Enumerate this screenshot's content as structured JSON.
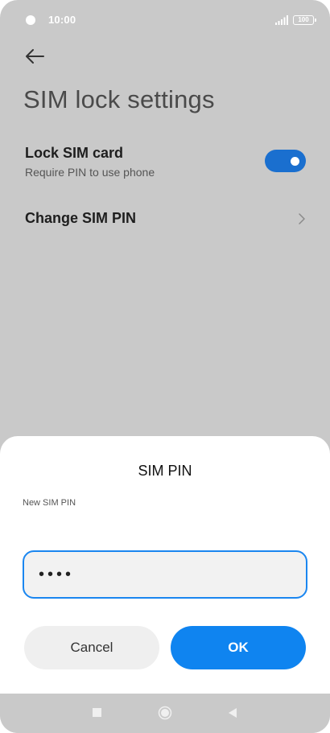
{
  "status_bar": {
    "time": "10:00",
    "battery": "100",
    "icons": [
      "status-dot-icon",
      "signal-icon",
      "battery-icon"
    ]
  },
  "header": {
    "back_icon": "back-arrow-icon",
    "title": "SIM lock settings"
  },
  "settings": {
    "lock_sim": {
      "title": "Lock SIM card",
      "subtitle": "Require PIN to use phone",
      "toggle_on": true
    },
    "change_pin": {
      "title": "Change SIM PIN",
      "icon": "chevron-right-icon"
    }
  },
  "dialog": {
    "title": "SIM PIN",
    "field_label": "New SIM PIN",
    "pin_value": "••••",
    "cancel_label": "Cancel",
    "ok_label": "OK"
  },
  "nav_bar": {
    "icons": [
      "recents-square-icon",
      "home-circle-icon",
      "back-triangle-icon"
    ]
  },
  "colors": {
    "background_dim": "#c9c9c9",
    "accent": "#0f84f0",
    "toggle": "#1a6fcf",
    "sheet": "#ffffff"
  }
}
